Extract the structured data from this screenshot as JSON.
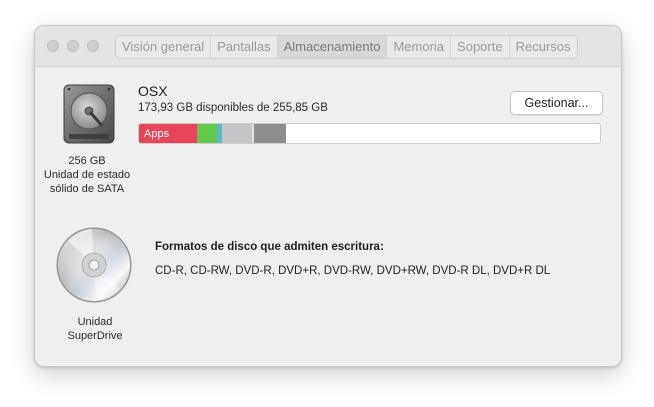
{
  "window": {
    "tabs": [
      {
        "label": "Visión general"
      },
      {
        "label": "Pantallas"
      },
      {
        "label": "Almacenamiento"
      },
      {
        "label": "Memoria"
      },
      {
        "label": "Soporte"
      },
      {
        "label": "Recursos"
      }
    ],
    "active_tab": "Almacenamiento"
  },
  "disk": {
    "icon": "hard-drive-icon",
    "caption_line1": "256 GB",
    "caption_line2": "Unidad de estado",
    "caption_line3": "sólido de SATA",
    "volume_name": "OSX",
    "available_text": "173,93 GB disponibles de 255,85 GB",
    "manage_button": "Gestionar...",
    "usage": {
      "total_gb": 255.85,
      "available_gb": 173.93,
      "segments": [
        {
          "label": "Apps",
          "fraction": 0.125,
          "color": "#e8455a"
        },
        {
          "label": "",
          "fraction": 0.045,
          "color": "#62c94f"
        },
        {
          "label": "",
          "fraction": 0.01,
          "color": "#5fb6d4"
        },
        {
          "label": "",
          "fraction": 0.065,
          "color": "#c5c5c8"
        },
        {
          "label": "",
          "fraction": 0.005,
          "color": "#e2e2e2"
        },
        {
          "label": "",
          "fraction": 0.07,
          "color": "#8e8e8e"
        }
      ]
    }
  },
  "optical": {
    "icon": "cd-disc-icon",
    "caption_line1": "Unidad",
    "caption_line2": "SuperDrive",
    "formats_title": "Formatos de disco que admiten escritura:",
    "formats_list": "CD-R, CD-RW, DVD-R, DVD+R, DVD-RW, DVD+RW, DVD-R DL, DVD+R DL"
  }
}
